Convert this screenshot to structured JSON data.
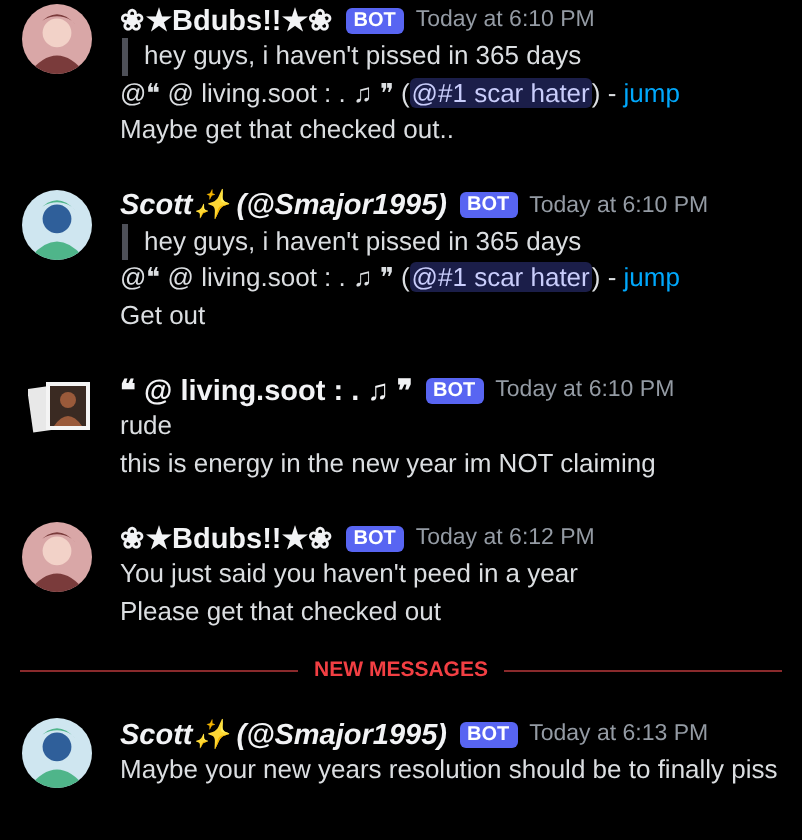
{
  "messages": [
    {
      "kind": "pink",
      "author": "❀★Bdubs!!★❀",
      "italic": false,
      "badge": "BOT",
      "time": "Today at 6:10 PM",
      "reply": {
        "quote": "hey guys, i haven't pissed in 365 days",
        "prefix": "@❝  @ living.soot  :  . ♫ ❞ (",
        "mention": "@#1 scar hater",
        "suffix": ") -",
        "link": "jump"
      },
      "lines": [
        "Maybe get that checked out.."
      ]
    },
    {
      "kind": "blue",
      "author": "Scott✨ (@Smajor1995)",
      "italic": true,
      "badge": "BOT",
      "time": "Today at 6:10 PM",
      "reply": {
        "quote": "hey guys, i haven't pissed in 365 days",
        "prefix": "@❝  @ living.soot  :  . ♫ ❞ (",
        "mention": "@#1 scar hater",
        "suffix": ") -",
        "link": "jump"
      },
      "lines": [
        "Get out"
      ]
    },
    {
      "kind": "photo",
      "author": "❝  @ living.soot  :  . ♫ ❞",
      "italic": false,
      "badge": "BOT",
      "time": "Today at 6:10 PM",
      "lines": [
        "rude",
        "this is energy in the new year im NOT claiming"
      ]
    },
    {
      "kind": "pink",
      "author": "❀★Bdubs!!★❀",
      "italic": false,
      "badge": "BOT",
      "time": "Today at 6:12 PM",
      "lines": [
        "You just said you haven't peed in a year",
        "Please get that checked out"
      ]
    },
    {
      "divider": "NEW MESSAGES",
      "kind": "blue",
      "author": "Scott✨ (@Smajor1995)",
      "italic": true,
      "badge": "BOT",
      "time": "Today at 6:13 PM",
      "lines": [
        "Maybe your new years resolution should be to finally piss"
      ]
    }
  ]
}
